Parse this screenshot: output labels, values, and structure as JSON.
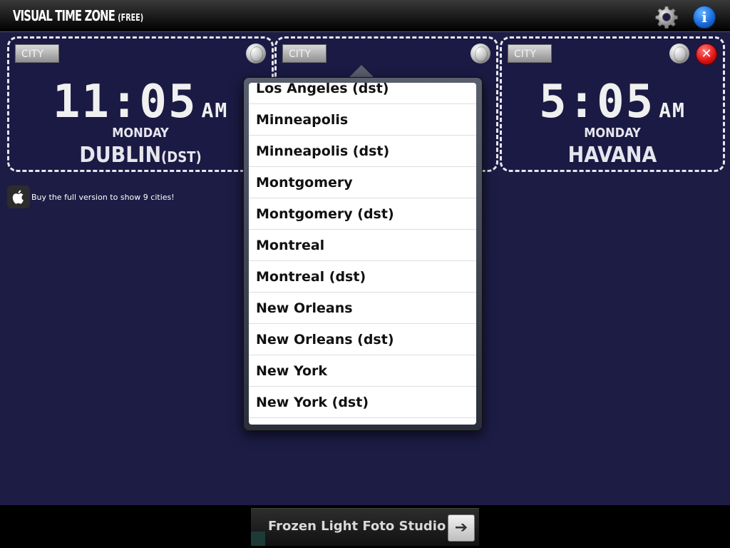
{
  "app": {
    "title": "VISUAL TIME ZONE",
    "edition": "(FREE)"
  },
  "toolbar": {
    "settings_icon": "gear-icon",
    "info_icon": "info-icon",
    "info_glyph": "i"
  },
  "clocks": [
    {
      "city_button_label": "CITY",
      "time": "11:05",
      "ampm": "AM",
      "day": "MONDAY",
      "city": "DUBLIN",
      "dst": "(DST)"
    },
    {
      "city_button_label": "CITY"
    },
    {
      "city_button_label": "CITY",
      "time": "5:05",
      "ampm": "AM",
      "day": "MONDAY",
      "city": "HAVANA",
      "close_glyph": "✕"
    }
  ],
  "promo": {
    "text": "Buy the full version to show 9 cities!",
    "icon": "apple-icon"
  },
  "city_picker": {
    "items": [
      "Los Angeles (dst)",
      "Minneapolis",
      "Minneapolis (dst)",
      "Montgomery",
      "Montgomery (dst)",
      "Montreal",
      "Montreal (dst)",
      "New Orleans",
      "New Orleans (dst)",
      "New York",
      "New York (dst)"
    ]
  },
  "ad": {
    "text": "Frozen Light Foto Studio",
    "arrow_glyph": "➔"
  },
  "colors": {
    "background": "#1d1c45",
    "close_red": "#dd1111",
    "info_blue": "#1468d6"
  }
}
